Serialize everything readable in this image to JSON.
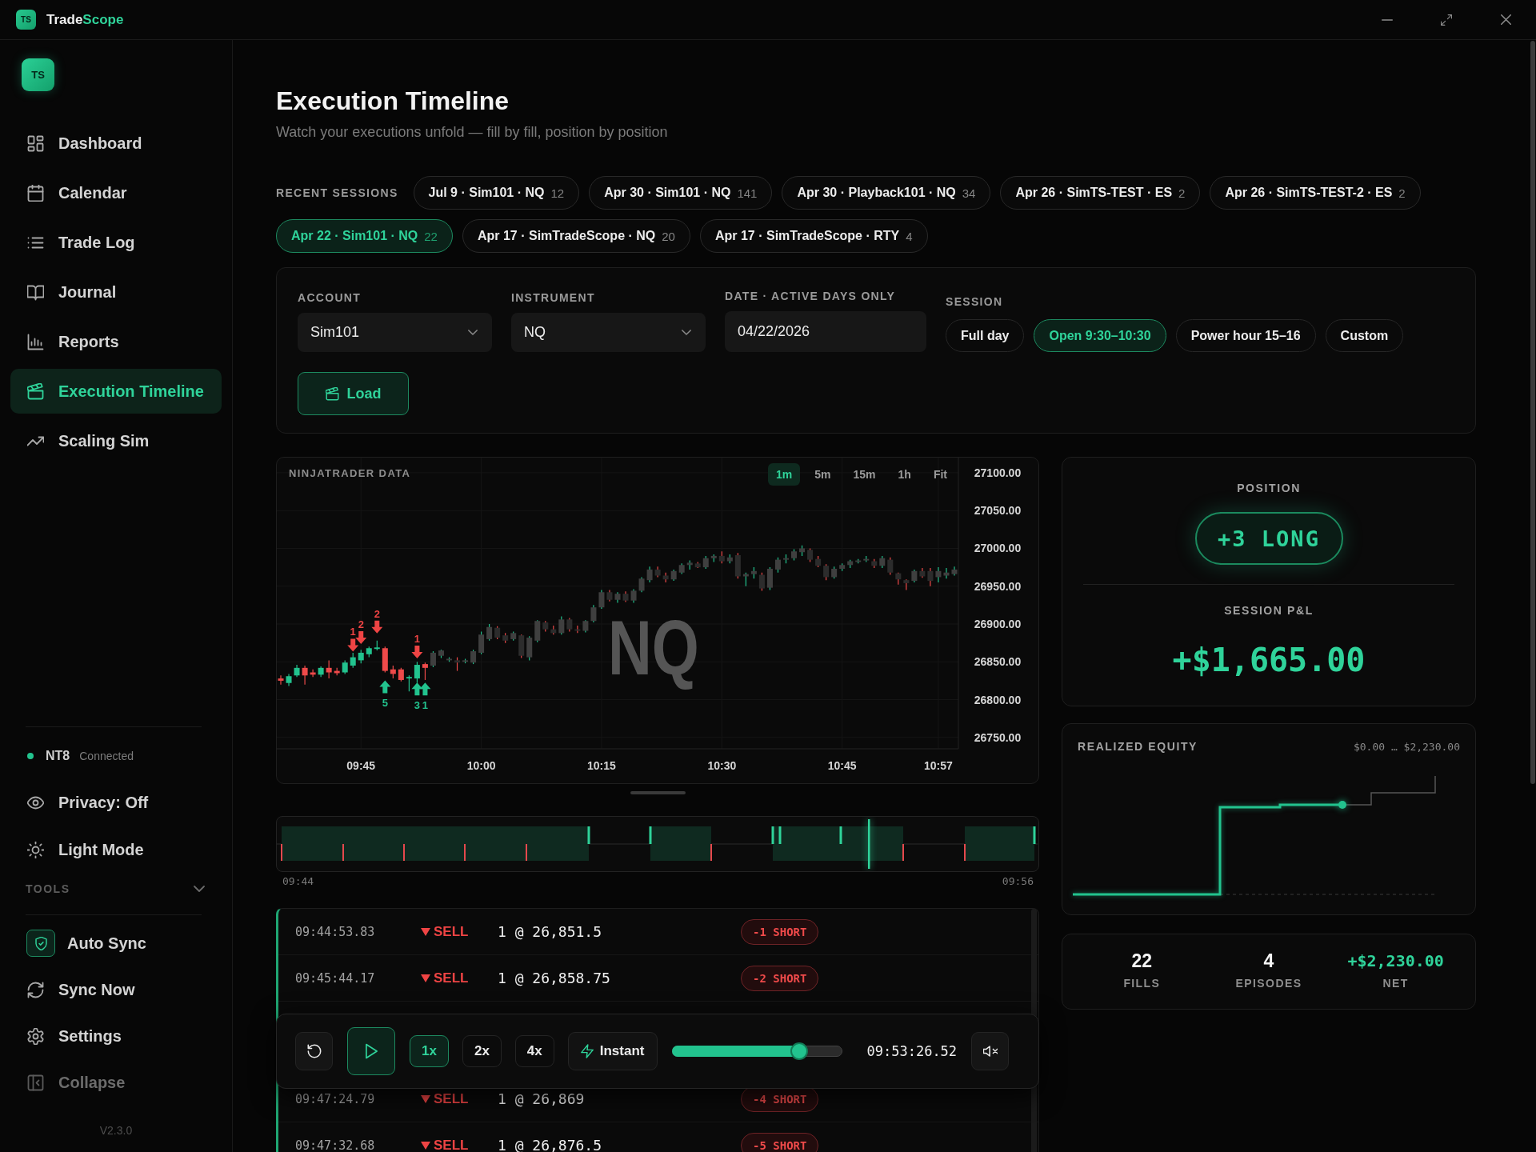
{
  "window": {
    "logo": "TS",
    "title_lead": "Trade",
    "title_accent": "Scope",
    "controls": [
      {
        "kind": "minimize"
      },
      {
        "kind": "maximize"
      },
      {
        "kind": "close"
      }
    ]
  },
  "sidebar": {
    "logo": "TS",
    "nav": [
      {
        "label": "Dashboard",
        "selected": false
      },
      {
        "label": "Calendar",
        "selected": false
      },
      {
        "label": "Trade Log",
        "selected": false
      },
      {
        "label": "Journal",
        "selected": false
      },
      {
        "label": "Reports",
        "selected": false
      },
      {
        "label": "Execution Timeline",
        "selected": true
      },
      {
        "label": "Scaling Sim",
        "selected": false
      }
    ],
    "connection": {
      "name": "NT8",
      "status": "Connected",
      "connected": true
    },
    "toggles": [
      {
        "label": "Privacy: Off"
      },
      {
        "label": "Light Mode"
      }
    ],
    "tools": {
      "label": "TOOLS",
      "expanded": true,
      "items": [
        {
          "label": "Auto Sync",
          "on": true
        },
        {
          "label": "Sync Now",
          "on": false
        },
        {
          "label": "Settings",
          "on": false
        }
      ]
    },
    "collapse": "Collapse",
    "version": "V2.3.0"
  },
  "page": {
    "title": "Execution Timeline",
    "subtitle": "Watch your executions unfold — fill by fill, position by position"
  },
  "recent_sessions": {
    "label": "RECENT SESSIONS",
    "items": [
      {
        "label": "Jul 9 · Sim101 · NQ",
        "count": "12",
        "selected": false
      },
      {
        "label": "Apr 30 · Sim101 · NQ",
        "count": "141",
        "selected": false
      },
      {
        "label": "Apr 30 · Playback101 · NQ",
        "count": "34",
        "selected": false
      },
      {
        "label": "Apr 26 · SimTS-TEST · ES",
        "count": "2",
        "selected": false
      },
      {
        "label": "Apr 26 · SimTS-TEST-2 · ES",
        "count": "2",
        "selected": false
      },
      {
        "label": "Apr 22 · Sim101 · NQ",
        "count": "22",
        "selected": true
      },
      {
        "label": "Apr 17 · SimTradeScope · NQ",
        "count": "20",
        "selected": false
      },
      {
        "label": "Apr 17 · SimTradeScope · RTY",
        "count": "4",
        "selected": false
      }
    ]
  },
  "filters": {
    "fields": [
      {
        "label": "ACCOUNT",
        "value": "Sim101",
        "kind": "select"
      },
      {
        "label": "INSTRUMENT",
        "value": "NQ",
        "kind": "select"
      },
      {
        "label": "DATE · ACTIVE DAYS ONLY",
        "value": "04/22/2026",
        "kind": "date"
      }
    ],
    "session": {
      "label": "SESSION",
      "options": [
        {
          "label": "Full day",
          "selected": false
        },
        {
          "label": "Open 9:30–10:30",
          "selected": true
        },
        {
          "label": "Power hour 15–16",
          "selected": false
        },
        {
          "label": "Custom",
          "selected": false
        }
      ]
    },
    "load_button": "Load"
  },
  "chart": {
    "timeframes": [
      {
        "label": "1m",
        "selected": true
      },
      {
        "label": "5m",
        "selected": false
      },
      {
        "label": "15m",
        "selected": false
      },
      {
        "label": "1h",
        "selected": false
      },
      {
        "label": "Fit",
        "selected": false
      }
    ],
    "watermark": "NQ",
    "markers": [
      {
        "kind": "sell",
        "label": "1"
      },
      {
        "kind": "sell",
        "label": "2"
      },
      {
        "kind": "sell",
        "label": "2"
      },
      {
        "kind": "buy",
        "label": "5"
      },
      {
        "kind": "sell",
        "label": "1"
      },
      {
        "kind": "buy",
        "label": "3"
      },
      {
        "kind": "buy",
        "label": "1"
      }
    ],
    "chart_data": {
      "type": "candlestick",
      "title": "NINJATRADER DATA",
      "grid": true,
      "categories": [
        null,
        null,
        null,
        null,
        null,
        null,
        null,
        null,
        null,
        null,
        "09:45",
        null,
        null,
        null,
        null,
        null,
        null,
        null,
        null,
        null,
        null,
        null,
        null,
        null,
        null,
        "10:00",
        null,
        null,
        null,
        null,
        null,
        null,
        null,
        null,
        null,
        null,
        null,
        null,
        null,
        null,
        "10:15",
        null,
        null,
        null,
        null,
        null,
        null,
        null,
        null,
        null,
        null,
        null,
        null,
        null,
        null,
        "10:30",
        null,
        null,
        null,
        null,
        null,
        null,
        null,
        null,
        null,
        null,
        null,
        null,
        null,
        null,
        "10:45",
        null,
        null,
        null,
        null,
        null,
        null,
        null,
        null,
        null,
        null,
        null,
        "10:57",
        null,
        null
      ],
      "ohlc": [
        [
          26828,
          26832,
          26820,
          26825
        ],
        [
          26822,
          26834,
          26818,
          26831
        ],
        [
          26832,
          26846,
          26830,
          26842
        ],
        [
          26842,
          26845,
          26820,
          26832
        ],
        [
          26836,
          26840,
          26830,
          26833
        ],
        [
          26833,
          26844,
          26830,
          26842
        ],
        [
          26842,
          26852,
          26828,
          26836
        ],
        [
          26838,
          26842,
          26832,
          26835
        ],
        [
          26836,
          26852,
          26834,
          26849
        ],
        [
          26845,
          26862,
          26842,
          26856
        ],
        [
          26852,
          26866,
          26848,
          26862
        ],
        [
          26860,
          26870,
          26856,
          26868
        ],
        [
          26867,
          26878,
          26865,
          26869
        ],
        [
          26868,
          26870,
          26836,
          26838
        ],
        [
          26840,
          26845,
          26828,
          26834
        ],
        [
          26840,
          26842,
          26824,
          26826
        ],
        [
          26828,
          26832,
          26811,
          26830
        ],
        [
          26828,
          26850,
          26822,
          26846
        ],
        [
          26847,
          26849,
          26826,
          26842
        ],
        [
          26845,
          26864,
          26843,
          26862
        ],
        [
          26858,
          26866,
          26855,
          26865
        ],
        [
          26852,
          26856,
          26850,
          26854
        ],
        [
          26852,
          26856,
          26838,
          26849
        ],
        [
          26850,
          26854,
          26848,
          26852
        ],
        [
          26849,
          26866,
          26847,
          26864
        ],
        [
          26862,
          26890,
          26860,
          26886
        ],
        [
          26880,
          26900,
          26878,
          26896
        ],
        [
          26895,
          26897,
          26880,
          26882
        ],
        [
          26885,
          26888,
          26875,
          26878
        ],
        [
          26880,
          26890,
          26878,
          26888
        ],
        [
          26885,
          26886,
          26855,
          26858
        ],
        [
          26856,
          26884,
          26852,
          26882
        ],
        [
          26878,
          26905,
          26876,
          26904
        ],
        [
          26902,
          26904,
          26890,
          26893
        ],
        [
          26893,
          26898,
          26886,
          26888
        ],
        [
          26888,
          26910,
          26886,
          26906
        ],
        [
          26906,
          26908,
          26890,
          26893
        ],
        [
          26893,
          26898,
          26888,
          26891
        ],
        [
          26891,
          26905,
          26889,
          26904
        ],
        [
          26904,
          26925,
          26902,
          26922
        ],
        [
          26922,
          26945,
          26920,
          26942
        ],
        [
          26942,
          26945,
          26930,
          26932
        ],
        [
          26932,
          26942,
          26928,
          26940
        ],
        [
          26940,
          26943,
          26929,
          26931
        ],
        [
          26931,
          26946,
          26928,
          26944
        ],
        [
          26944,
          26962,
          26942,
          26960
        ],
        [
          26958,
          26976,
          26955,
          26972
        ],
        [
          26972,
          26976,
          26962,
          26964
        ],
        [
          26964,
          26968,
          26955,
          26959
        ],
        [
          26959,
          26972,
          26957,
          26970
        ],
        [
          26968,
          26980,
          26966,
          26978
        ],
        [
          26978,
          26984,
          26972,
          26981
        ],
        [
          26980,
          26982,
          26974,
          26975
        ],
        [
          26975,
          26990,
          26973,
          26987
        ],
        [
          26987,
          26992,
          26982,
          26990
        ],
        [
          26990,
          26996,
          26980,
          26983
        ],
        [
          26983,
          26992,
          26980,
          26988
        ],
        [
          26991,
          26994,
          26960,
          26963
        ],
        [
          26963,
          26968,
          26950,
          26966
        ],
        [
          26966,
          26975,
          26960,
          26970
        ],
        [
          26965,
          26968,
          26944,
          26947
        ],
        [
          26948,
          26975,
          26945,
          26973
        ],
        [
          26972,
          26988,
          26968,
          26985
        ],
        [
          26985,
          26992,
          26980,
          26987
        ],
        [
          26987,
          26999,
          26984,
          26996
        ],
        [
          26995,
          27004,
          26990,
          27000
        ],
        [
          26998,
          27000,
          26982,
          26985
        ],
        [
          26986,
          26990,
          26975,
          26977
        ],
        [
          26977,
          26979,
          26958,
          26962
        ],
        [
          26962,
          26976,
          26960,
          26973
        ],
        [
          26973,
          26980,
          26970,
          26978
        ],
        [
          26978,
          26985,
          26974,
          26983
        ],
        [
          26982,
          26986,
          26980,
          26984
        ],
        [
          26984,
          26990,
          26982,
          26986
        ],
        [
          26983,
          26986,
          26974,
          26977
        ],
        [
          26977,
          26990,
          26974,
          26987
        ],
        [
          26985,
          26988,
          26965,
          26968
        ],
        [
          26967,
          26968,
          26952,
          26959
        ],
        [
          26958,
          26959,
          26945,
          26954
        ],
        [
          26957,
          26972,
          26955,
          26970
        ],
        [
          26970,
          26974,
          26961,
          26963
        ],
        [
          26970,
          26974,
          26950,
          26957
        ],
        [
          26962,
          26975,
          26955,
          26970
        ],
        [
          26964,
          26974,
          26960,
          26968
        ],
        [
          26966,
          26976,
          26964,
          26972
        ]
      ],
      "ylim": [
        26735,
        27120
      ],
      "yticks": [
        {
          "value": 27100,
          "label": "27100.00"
        },
        {
          "value": 27050,
          "label": "27050.00"
        },
        {
          "value": 27000,
          "label": "27000.00"
        },
        {
          "value": 26950,
          "label": "26950.00"
        },
        {
          "value": 26900,
          "label": "26900.00"
        },
        {
          "value": 26850,
          "label": "26850.00"
        },
        {
          "value": 26800,
          "label": "26800.00"
        },
        {
          "value": 26750,
          "label": "26750.00"
        }
      ]
    }
  },
  "timeline": {
    "start": "09:44",
    "end": "09:56"
  },
  "fills": [
    {
      "time": "09:44:53.83",
      "kind": "sell",
      "side": "SELL",
      "fill": "1 @ 26,851.5",
      "position": "-1 SHORT",
      "short": true
    },
    {
      "time": "09:45:44.17",
      "kind": "sell",
      "side": "SELL",
      "fill": "1 @ 26,858.75",
      "position": "-2 SHORT",
      "short": true
    },
    {
      "time": "09:47:24.79",
      "kind": "sell",
      "side": "SELL",
      "fill": "1 @ 26,869",
      "position": "-4 SHORT",
      "short": true
    },
    {
      "time": "09:47:32.68",
      "kind": "sell",
      "side": "SELL",
      "fill": "1 @ 26,876.5",
      "position": "-5 SHORT",
      "short": true
    }
  ],
  "playback": {
    "playing": false,
    "speeds": [
      {
        "label": "1x",
        "selected": true
      },
      {
        "label": "2x",
        "selected": false
      },
      {
        "label": "4x",
        "selected": false
      }
    ],
    "instant": "Instant",
    "level": 0.78,
    "time": "09:53:26.52",
    "muted": true
  },
  "position_panel": {
    "label": "POSITION",
    "value": "+3 LONG",
    "long": true,
    "pnl_label": "SESSION P&L",
    "pnl": "+$1,665.00",
    "pnl_positive": true
  },
  "equity": {
    "title": "REALIZED EQUITY",
    "range": "$0.00 … $2,230.00"
  },
  "stats": [
    {
      "value": "22",
      "label": "FILLS",
      "kind": "count"
    },
    {
      "value": "4",
      "label": "EPISODES",
      "kind": "count"
    },
    {
      "value": "+$2,230.00",
      "label": "NET",
      "kind": "gain"
    }
  ]
}
